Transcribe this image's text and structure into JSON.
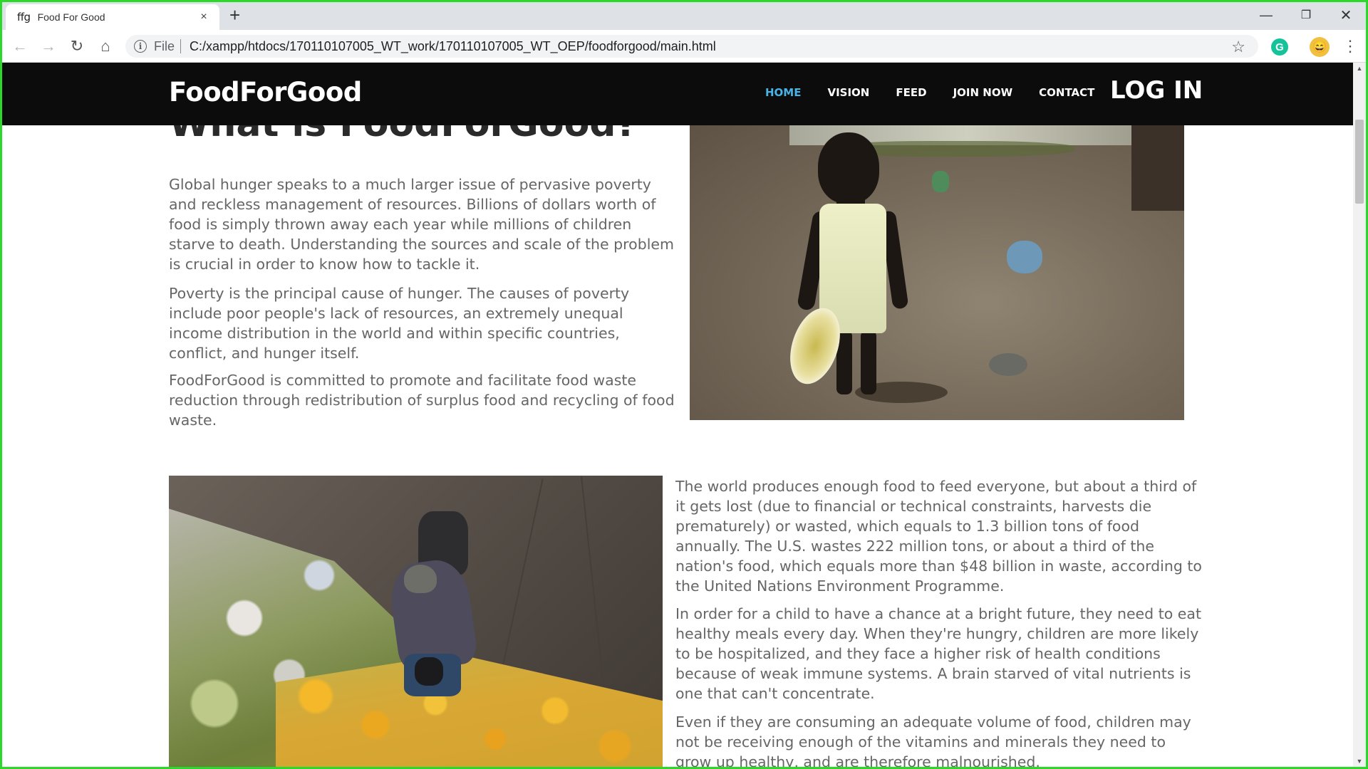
{
  "browser": {
    "tab_favicon": "ffg",
    "tab_title": "Food For Good",
    "tab_close": "×",
    "new_tab": "+",
    "url_scheme": "File",
    "url": "C:/xampp/htdocs/170110107005_WT_work/170110107005_WT_OEP/foodforgood/main.html",
    "extension_letter": "G",
    "icons": [
      "back-icon",
      "forward-icon",
      "reload-icon",
      "home-icon",
      "info-icon",
      "star-icon",
      "menu-icon",
      "minimize-icon",
      "restore-icon",
      "close-icon"
    ]
  },
  "nav": {
    "brand": "FoodForGood",
    "links": [
      "HOME",
      "VISION",
      "FEED",
      "JOIN NOW",
      "CONTACT"
    ],
    "active": "HOME",
    "login": "LOG IN",
    "active_color": "#4ab3e6"
  },
  "main": {
    "heading": "What is FoodForGood?",
    "paragraphs_top": [
      "Global hunger speaks to a much larger issue of pervasive poverty and reckless management of resources. Billions of dollars worth of food is simply thrown away each year while millions of children starve to death. Understanding the sources and scale of the problem is crucial in order to know how to tackle it.",
      "Poverty is the principal cause of hunger. The causes of poverty include poor people's lack of resources, an extremely unequal income distribution in the world and within specific countries, conflict, and hunger itself.",
      "FoodForGood is committed to promote and facilitate food waste reduction through redistribution of surplus food and recycling of food waste."
    ],
    "paragraphs_bottom": [
      "The world produces enough food to feed everyone, but about a third of it gets lost (due to financial or technical constraints, harvests die prematurely) or wasted, which equals to 1.3 billion tons of food annually. The U.S. wastes 222 million tons, or about a third of the nation's food, which equals more than $48 billion in waste, according to the United Nations Environment Programme.",
      "In order for a child to have a chance at a bright future, they need to eat healthy meals every day. When they're hungry, children are more likely to be hospitalized, and they face a higher risk of health conditions because of weak immune systems. A brain starved of vital nutrients is one that can't concentrate.",
      "Even if they are consuming an adequate volume of food, children may not be receiving enough of the vitamins and minerals they need to grow up healthy, and are therefore malnourished."
    ]
  },
  "colors": {
    "nav_bg": "#0c0c0c",
    "frame": "#2bd92b",
    "text": "#666666",
    "heading": "#2a2a2a"
  }
}
